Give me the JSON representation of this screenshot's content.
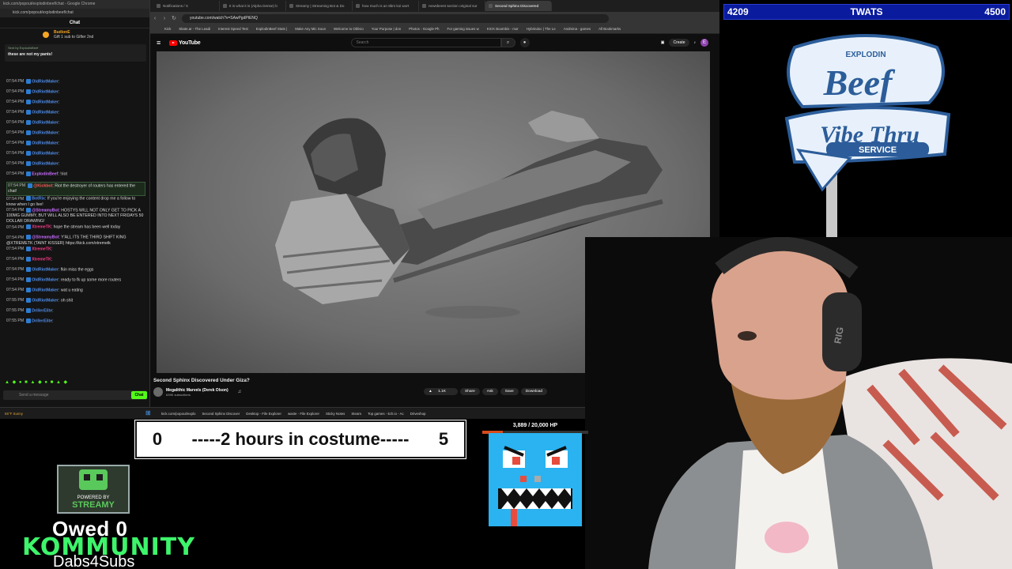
{
  "chat_window": {
    "title_bar": "kick.com/popout/explodinbeef/chat - Google Chrome",
    "url": "kick.com/popout/explodinbeef/chat",
    "header": "Chat",
    "gift_name": "BudionE",
    "gift_text": "Gift 1 sub to Gifter 2nd",
    "pinned_by": "Sent by ExplodinBeef",
    "pinned_text": "these are not my pants!",
    "input_placeholder": "Send a message",
    "send_label": "Chat",
    "emote_row": "▲ ◆ ● ■ ▲ ◆ ● ■ ▲ ◆"
  },
  "chat_messages": [
    {
      "time": "07:54 PM",
      "user": "OldRiotMaker",
      "color": "#4f8ce8",
      "text": ":"
    },
    {
      "time": "07:54 PM",
      "user": "OldRiotMaker",
      "color": "#4f8ce8",
      "text": ":"
    },
    {
      "time": "07:54 PM",
      "user": "OldRiotMaker",
      "color": "#4f8ce8",
      "text": ":"
    },
    {
      "time": "07:54 PM",
      "user": "OldRiotMaker",
      "color": "#4f8ce8",
      "text": ":"
    },
    {
      "time": "07:54 PM",
      "user": "OldRiotMaker",
      "color": "#4f8ce8",
      "text": ":"
    },
    {
      "time": "07:54 PM",
      "user": "OldRiotMaker",
      "color": "#4f8ce8",
      "text": ":"
    },
    {
      "time": "07:54 PM",
      "user": "OldRiotMaker",
      "color": "#4f8ce8",
      "text": ":"
    },
    {
      "time": "07:54 PM",
      "user": "OldRiotMaker",
      "color": "#4f8ce8",
      "text": ":"
    },
    {
      "time": "07:54 PM",
      "user": "OldRiotMaker",
      "color": "#4f8ce8",
      "text": ":"
    },
    {
      "time": "07:54 PM",
      "user": "ExplodinBeef",
      "color": "#c86bff",
      "text": ": !riot"
    },
    {
      "time": "07:54 PM",
      "user": "@Kickbot",
      "color": "#ff5a5a",
      "text": ": Riot the destroyer of routers has entered the chat!"
    },
    {
      "time": "07:54 PM",
      "user": "BotRix",
      "color": "#4f8ce8",
      "text": ": If you're enjoying the content drop me a follow to know when I go live!"
    },
    {
      "time": "07:54 PM",
      "user": "@StreamyBot",
      "color": "#c86bff",
      "text": ": HOSTYS WILL NOT ONLY GET TO PICK A 100MG GUMMY, BUT WILL ALSO BE ENTERED INTO NEXT FRIDAYS 50 DOLLAR DRAWING!"
    },
    {
      "time": "07:54 PM",
      "user": "XtremeTK",
      "color": "#ff3a8a",
      "text": ": hope the stream has been well today"
    },
    {
      "time": "07:54 PM",
      "user": "@StreamyBot",
      "color": "#c86bff",
      "text": ": Y'ALL ITS THE THIRD SHIFT KING @XTREMETK (TAINT KISSER) https://kick.com/xtremetk"
    },
    {
      "time": "07:54 PM",
      "user": "XtremeTK",
      "color": "#ff3a8a",
      "text": ":"
    },
    {
      "time": "07:54 PM",
      "user": "XtremeTK",
      "color": "#ff3a8a",
      "text": ":"
    },
    {
      "time": "07:54 PM",
      "user": "OldRiotMaker",
      "color": "#4f8ce8",
      "text": ": fkin miss the eggs"
    },
    {
      "time": "07:54 PM",
      "user": "OldRiotMaker",
      "color": "#4f8ce8",
      "text": ": ready to fk up some more routers"
    },
    {
      "time": "07:54 PM",
      "user": "OldRiotMaker",
      "color": "#4f8ce8",
      "text": ": wat u eating"
    },
    {
      "time": "07:55 PM",
      "user": "OldRiotMaker",
      "color": "#4f8ce8",
      "text": ": oh shit"
    },
    {
      "time": "07:55 PM",
      "user": "DrillerElite",
      "color": "#4f8ce8",
      "text": ":"
    },
    {
      "time": "07:55 PM",
      "user": "DrillerElite",
      "color": "#4f8ce8",
      "text": ":"
    }
  ],
  "browser": {
    "tabs": [
      "Notifications / X",
      "It is what it is (Alpha Dense) b",
      "Streamy | Streaming Bot & Do",
      "how much is an 8bm koi wort",
      "newsbeest section original sur",
      "Second Sphinx Discovered"
    ],
    "url": "youtube.com/watch?v=SAwPgdPtENQ",
    "bookmarks": [
      "Kick",
      "Skate.ar - The Leadi",
      "Interest Speed Test",
      "ExplodinBeef Stats |",
      "Make Any Mic Soun",
      "Welcome to Oblivio",
      "Your Purpose | don",
      "Photos - Google Ph",
      "For gaming issues w",
      "KICK Boombis - mor",
      "Hybrindoc | The Le",
      "Andmina - games",
      "All Bookmarks"
    ]
  },
  "youtube": {
    "logo": "YouTube",
    "search_placeholder": "Search",
    "create_label": "Create",
    "avatar_letter": "E",
    "video_title": "Second Sphinx Discovered Under Giza?",
    "channel": "Megalithic Marvels (Derek Olson)",
    "subscribers": "639K subscribers",
    "likes": "1.1K",
    "share": "Share",
    "ask": "Ask",
    "save": "Save",
    "download": "Download"
  },
  "taskbar": {
    "weather": "55°F Sunny",
    "tasks": [
      "kick.com/popout/explo",
      "Second Sphinx Discover",
      "Desktop - File Explorer",
      "waste - File Explorer",
      "Sticky Notes",
      "Steam",
      "Top games - itch.io - Ac",
      "Driveshop"
    ]
  },
  "counter_bar": {
    "left": "4209",
    "center": "TWATS",
    "right": "4500",
    "bg": "#0a1b9e"
  },
  "brand": {
    "line1": "EXPLODIN",
    "line2": "Beef",
    "line3": "Vibe Thru",
    "line4": "SERVICE"
  },
  "costume": {
    "left": "0",
    "text": "-----2 hours in costume-----",
    "right": "5"
  },
  "boss": {
    "hp_text": "3,889 / 20,000 HP",
    "hp_fraction": 0.194
  },
  "streamy": {
    "line1": "POWERED BY",
    "line2": "STREAMY"
  },
  "overlay_text": {
    "owed": "Owed 0",
    "community": "KOMMUNITY",
    "dabs": "Dabs4Subs"
  },
  "colors": {
    "kick_green": "#53fc18",
    "youtube_red": "#ff0000",
    "boss_cyan": "#2ab3f0"
  }
}
